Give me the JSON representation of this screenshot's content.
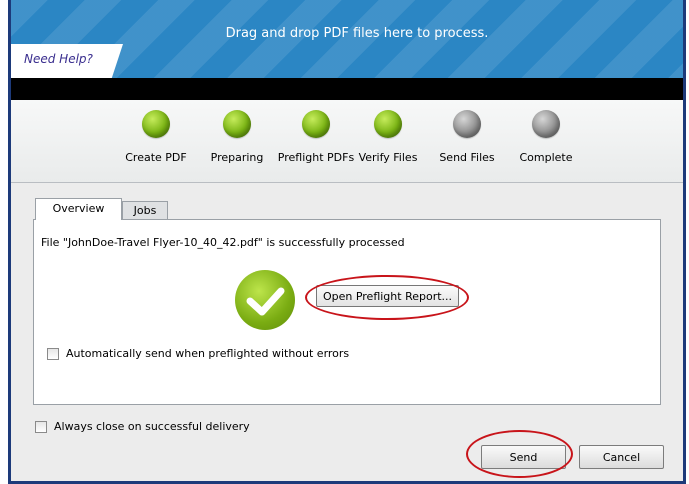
{
  "banner": {
    "drop_text": "Drag and drop PDF files here to process.",
    "help_link": "Need Help?"
  },
  "steps": [
    {
      "label": "Create PDF",
      "state": "done"
    },
    {
      "label": "Preparing",
      "state": "done"
    },
    {
      "label": "Preflight PDFs",
      "state": "done"
    },
    {
      "label": "Verify Files",
      "state": "done"
    },
    {
      "label": "Send Files",
      "state": "pending"
    },
    {
      "label": "Complete",
      "state": "pending"
    }
  ],
  "tabs": {
    "overview": "Overview",
    "jobs": "Jobs"
  },
  "overview": {
    "status_message": "File \"JohnDoe-Travel Flyer-10_40_42.pdf\" is successfully processed",
    "report_button": "Open Preflight Report...",
    "auto_send_label": "Automatically send when preflighted without errors",
    "auto_send_checked": false
  },
  "footer": {
    "always_close_label": "Always close on successful delivery",
    "always_close_checked": false,
    "send_button": "Send",
    "cancel_button": "Cancel"
  },
  "colors": {
    "step_done": "#7ab51d",
    "step_pending": "#8e8e8e",
    "annotation": "#c8141a",
    "banner": "#2b86c4"
  }
}
